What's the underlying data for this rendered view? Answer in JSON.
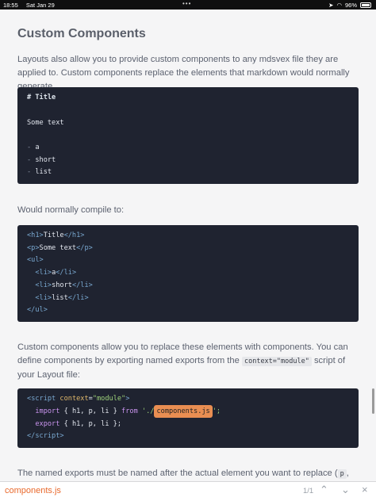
{
  "status": {
    "time": "18:55",
    "date": "Sat Jan 29",
    "battery": "96%"
  },
  "heading": "Custom Components",
  "para1": "Layouts also allow you to provide custom components to any mdsvex file they are applied to. Custom components replace the elements that markdown would normally generate.",
  "code1": {
    "title": "# Title",
    "text": "Some text",
    "items": [
      "a",
      "short",
      "list"
    ]
  },
  "para2": "Would normally compile to:",
  "code2": {
    "h1": "Title",
    "p": "Some text",
    "ul_open": "<ul>",
    "ul_close": "</ul>",
    "li": [
      "a",
      "short",
      "list"
    ]
  },
  "para3": {
    "a": "Custom components allow you to replace these elements with components. You can define components by exporting named exports from the ",
    "code": "context=\"module\"",
    "b": " script of your Layout file:"
  },
  "code3": {
    "open_tag": "script",
    "attr": "context",
    "attr_val": "\"module\"",
    "import_kw": "import",
    "import_names": "{ h1, p, li }",
    "from_kw": "from",
    "path_prefix": "'./",
    "path_highlight": "components.js",
    "path_suffix": "';",
    "export_kw": "export",
    "export_names": "{ h1, p, li };"
  },
  "para4": {
    "text": "The named exports must be named after the actual element you want to replace (",
    "code": "p"
  },
  "find": {
    "term": "components.js",
    "count": "1/1",
    "prev": "⌃",
    "next": "⌄",
    "done": "×"
  }
}
